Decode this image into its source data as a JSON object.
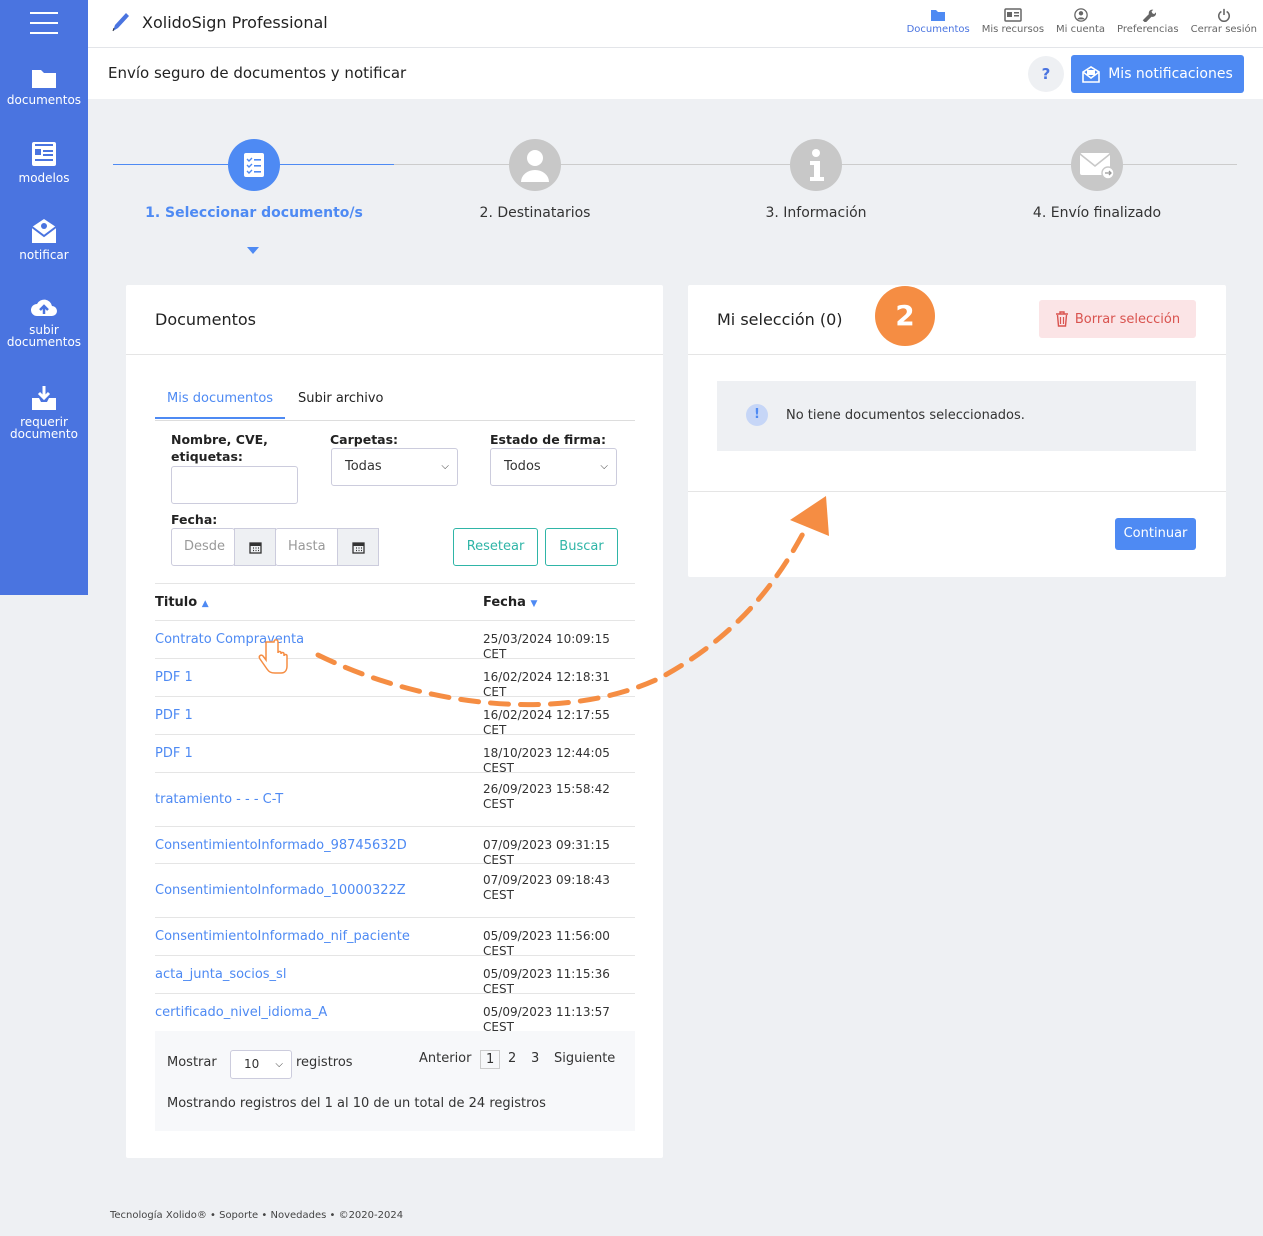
{
  "sidebar": {
    "items": [
      {
        "label": "documentos"
      },
      {
        "label": "modelos"
      },
      {
        "label": "notificar"
      },
      {
        "label": "subir documentos"
      },
      {
        "label": "requerir documento"
      }
    ]
  },
  "topbar": {
    "brand": "XolidoSign Professional",
    "nav": [
      {
        "label": "Documentos",
        "icon": "folder-icon"
      },
      {
        "label": "Mis recursos",
        "icon": "id-card-icon"
      },
      {
        "label": "Mi cuenta",
        "icon": "user-icon"
      },
      {
        "label": "Preferencias",
        "icon": "wrench-icon"
      },
      {
        "label": "Cerrar sesión",
        "icon": "power-icon"
      }
    ]
  },
  "subheader": {
    "title": "Envío seguro de documentos y notificar",
    "help_label": "?",
    "notifications_label": "Mis notificaciones"
  },
  "steps": [
    {
      "label": "1. Seleccionar documento/s"
    },
    {
      "label": "2. Destinatarios"
    },
    {
      "label": "3. Información"
    },
    {
      "label": "4. Envío finalizado"
    }
  ],
  "documents": {
    "title": "Documentos",
    "tabs": [
      {
        "label": "Mis documentos"
      },
      {
        "label": "Subir archivo"
      }
    ],
    "filters": {
      "name_label": "Nombre, CVE, etiquetas:",
      "folders_label": "Carpetas:",
      "folders_value": "Todas",
      "status_label": "Estado de firma:",
      "status_value": "Todos",
      "date_label": "Fecha:",
      "from_placeholder": "Desde",
      "to_placeholder": "Hasta",
      "reset_label": "Resetear",
      "search_label": "Buscar"
    },
    "columns": {
      "title": "Titulo",
      "date": "Fecha"
    },
    "rows": [
      {
        "title": "Contrato Compraventa",
        "date": "25/03/2024 10:09:15 CET"
      },
      {
        "title": "PDF 1",
        "date": "16/02/2024 12:18:31 CET"
      },
      {
        "title": "PDF 1",
        "date": "16/02/2024 12:17:55 CET"
      },
      {
        "title": "PDF 1",
        "date": "18/10/2023 12:44:05 CEST"
      },
      {
        "title": "tratamiento - - - C-T",
        "date": "26/09/2023 15:58:42 CEST"
      },
      {
        "title": "ConsentimientoInformado_98745632D",
        "date": "07/09/2023 09:31:15 CEST"
      },
      {
        "title": "ConsentimientoInformado_10000322Z",
        "date": "07/09/2023 09:18:43 CEST"
      },
      {
        "title": "ConsentimientoInformado_nif_paciente",
        "date": "05/09/2023 11:56:00 CEST"
      },
      {
        "title": "acta_junta_socios_sl",
        "date": "05/09/2023 11:15:36 CEST"
      },
      {
        "title": "certificado_nivel_idioma_A",
        "date": "05/09/2023 11:13:57 CEST"
      }
    ],
    "pager": {
      "show_label": "Mostrar",
      "page_size": "10",
      "records_label": "registros",
      "prev": "Anterior",
      "pages": [
        "1",
        "2",
        "3"
      ],
      "next": "Siguiente",
      "summary": "Mostrando registros del 1 al 10 de un total de 24 registros"
    }
  },
  "selection": {
    "title": "Mi selección (0)",
    "badge": "2",
    "clear_label": "Borrar selección",
    "empty_message": "No tiene documentos seleccionados.",
    "info_icon": "!",
    "continue_label": "Continuar"
  },
  "footer": {
    "text": "Tecnología Xolido® • Soporte • Novedades • ©2020-2024"
  },
  "colors": {
    "primary": "#4e8af3",
    "sidebar": "#4a74e0",
    "accent_orange": "#f58d43",
    "success_outline": "#2fb5a7",
    "danger": "#d9534f"
  }
}
